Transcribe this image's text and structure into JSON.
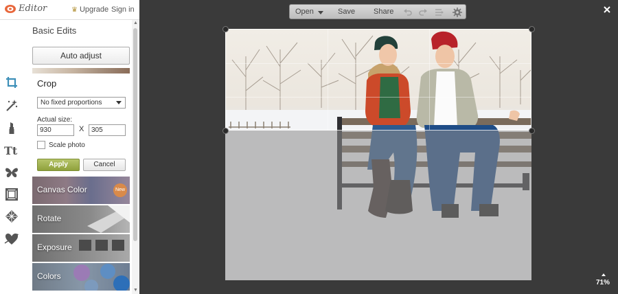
{
  "app": {
    "logo_text": "Editor",
    "upgrade_label": "Upgrade",
    "signin_label": "Sign in"
  },
  "panel": {
    "title": "Basic Edits",
    "auto_adjust_label": "Auto adjust",
    "crop": {
      "title": "Crop",
      "proportion_value": "No fixed proportions",
      "actual_size_label": "Actual size:",
      "width_value": "930",
      "height_value": "305",
      "times_sign": "X",
      "scale_photo_label": "Scale photo",
      "scale_photo_checked": false,
      "apply_label": "Apply",
      "cancel_label": "Cancel"
    },
    "effects": [
      {
        "label": "Canvas Color",
        "badge": "New"
      },
      {
        "label": "Rotate"
      },
      {
        "label": "Exposure"
      },
      {
        "label": "Colors"
      }
    ]
  },
  "tools": [
    "crop-icon",
    "magic-wand-icon",
    "lipstick-icon",
    "text-icon",
    "butterfly-icon",
    "frame-icon",
    "texture-icon",
    "heart-icon"
  ],
  "toolbar": {
    "open_label": "Open",
    "save_label": "Save",
    "share_label": "Share"
  },
  "zoom": "71%",
  "colors": {
    "accent_apply": "#9caf47",
    "badge": "#d98a4a",
    "workspace": "#3a3a3a"
  }
}
